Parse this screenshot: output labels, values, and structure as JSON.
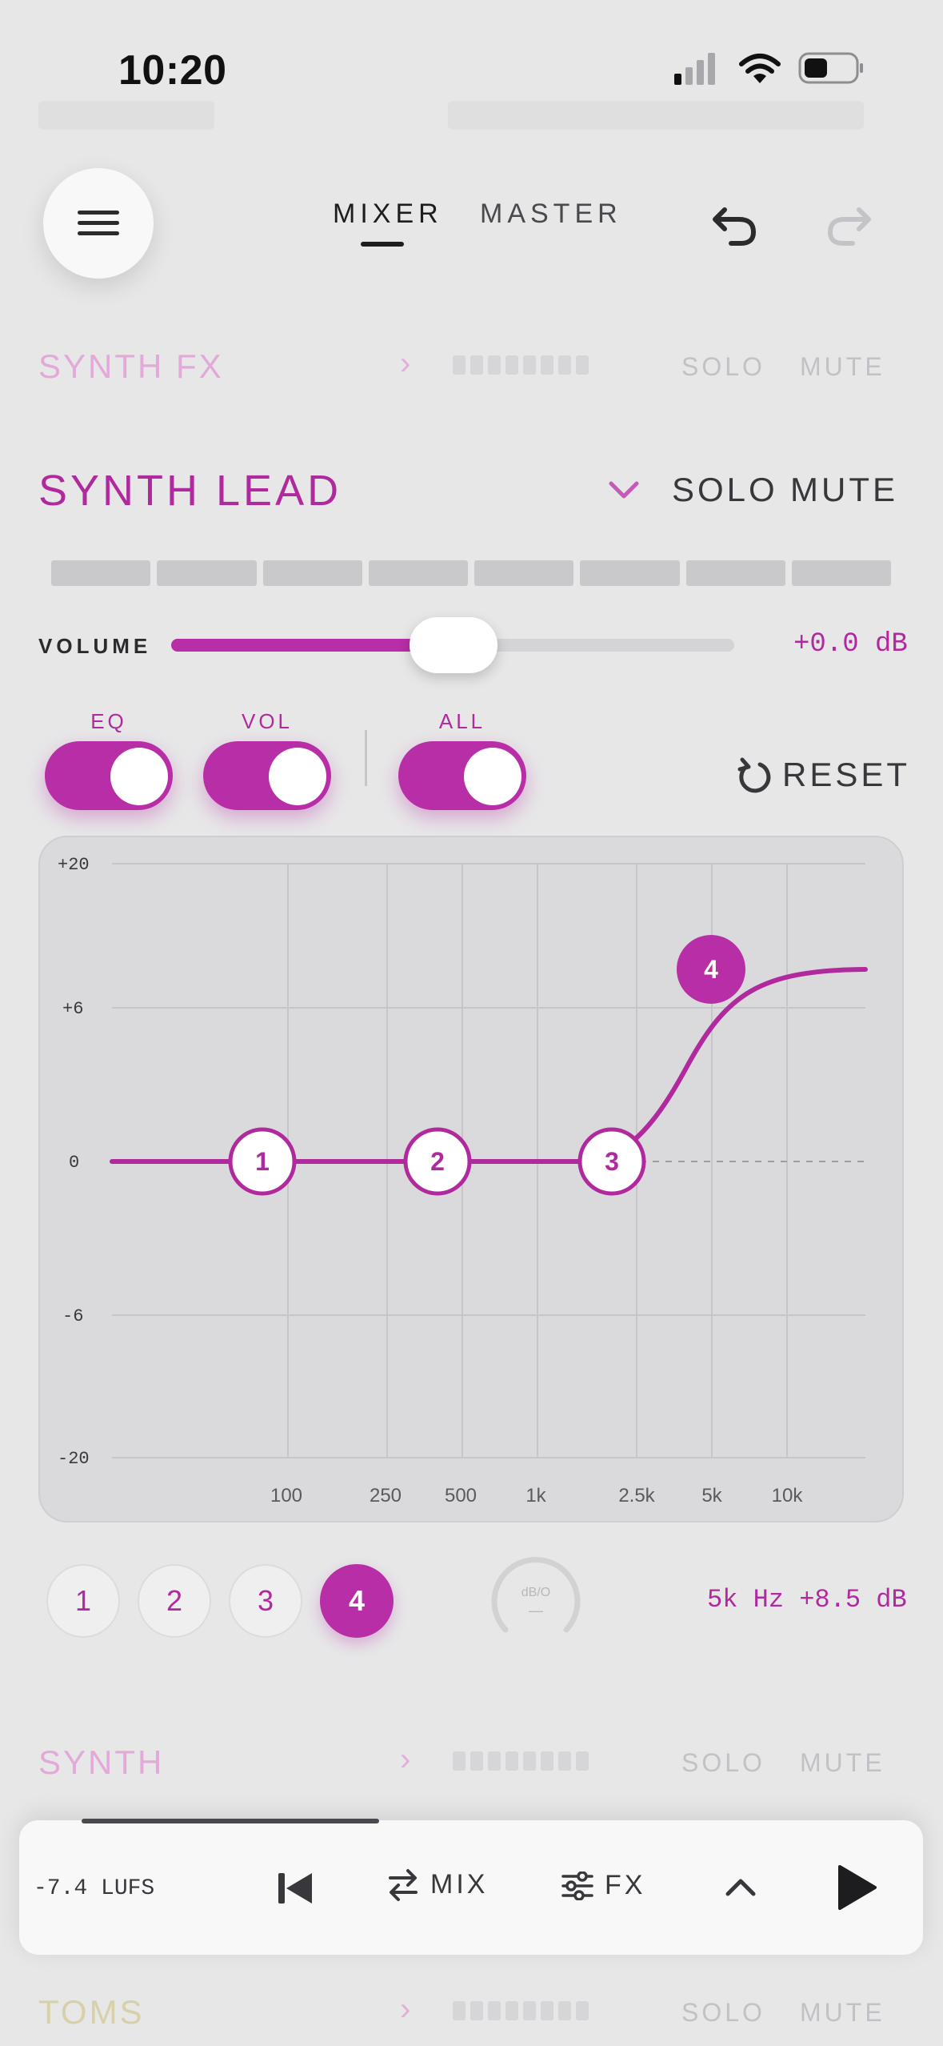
{
  "status_bar": {
    "time": "10:20"
  },
  "header": {
    "tabs": [
      {
        "label": "MIXER",
        "active": true
      },
      {
        "label": "MASTER",
        "active": false
      }
    ],
    "menu_icon": "hamburger-icon",
    "undo_icon": "undo-icon",
    "redo_icon": "redo-icon"
  },
  "rows": {
    "synth_fx": {
      "label": "SYNTH FX",
      "solo": "SOLO",
      "mute": "MUTE"
    },
    "synth": {
      "label": "SYNTH",
      "solo": "SOLO",
      "mute": "MUTE"
    },
    "toms": {
      "label": "TOMS",
      "solo": "SOLO",
      "mute": "MUTE"
    }
  },
  "channel": {
    "name": "SYNTH LEAD",
    "solo": "SOLO",
    "mute": "MUTE",
    "volume_label": "VOLUME",
    "volume_value": "+0.0 dB",
    "volume_level": 0.5,
    "toggles": [
      {
        "label": "EQ",
        "on": true
      },
      {
        "label": "VOL",
        "on": true
      },
      {
        "label": "ALL",
        "on": true
      }
    ],
    "reset_label": "RESET"
  },
  "eq": {
    "y_ticks": [
      "+20",
      "+6",
      "0",
      "-6",
      "-20"
    ],
    "x_ticks": [
      "100",
      "250",
      "500",
      "1k",
      "2.5k",
      "5k",
      "10k"
    ],
    "nodes": [
      {
        "label": "1",
        "freq": "100",
        "gain_db": 0
      },
      {
        "label": "2",
        "freq": "500",
        "gain_db": 0
      },
      {
        "label": "3",
        "freq": "2.5k",
        "gain_db": 0
      },
      {
        "label": "4",
        "freq": "5k",
        "gain_db": 8.5,
        "active": true
      }
    ],
    "q_label": "dB/O",
    "q_value": "—"
  },
  "band_buttons": [
    "1",
    "2",
    "3",
    "4"
  ],
  "band_readout": "5k Hz +8.5 dB",
  "transport": {
    "lufs": "-7.4 LUFS",
    "mix_label": "MIX",
    "fx_label": "FX"
  },
  "colors": {
    "accent": "#b72ea6",
    "background": "#e7e7e8"
  }
}
